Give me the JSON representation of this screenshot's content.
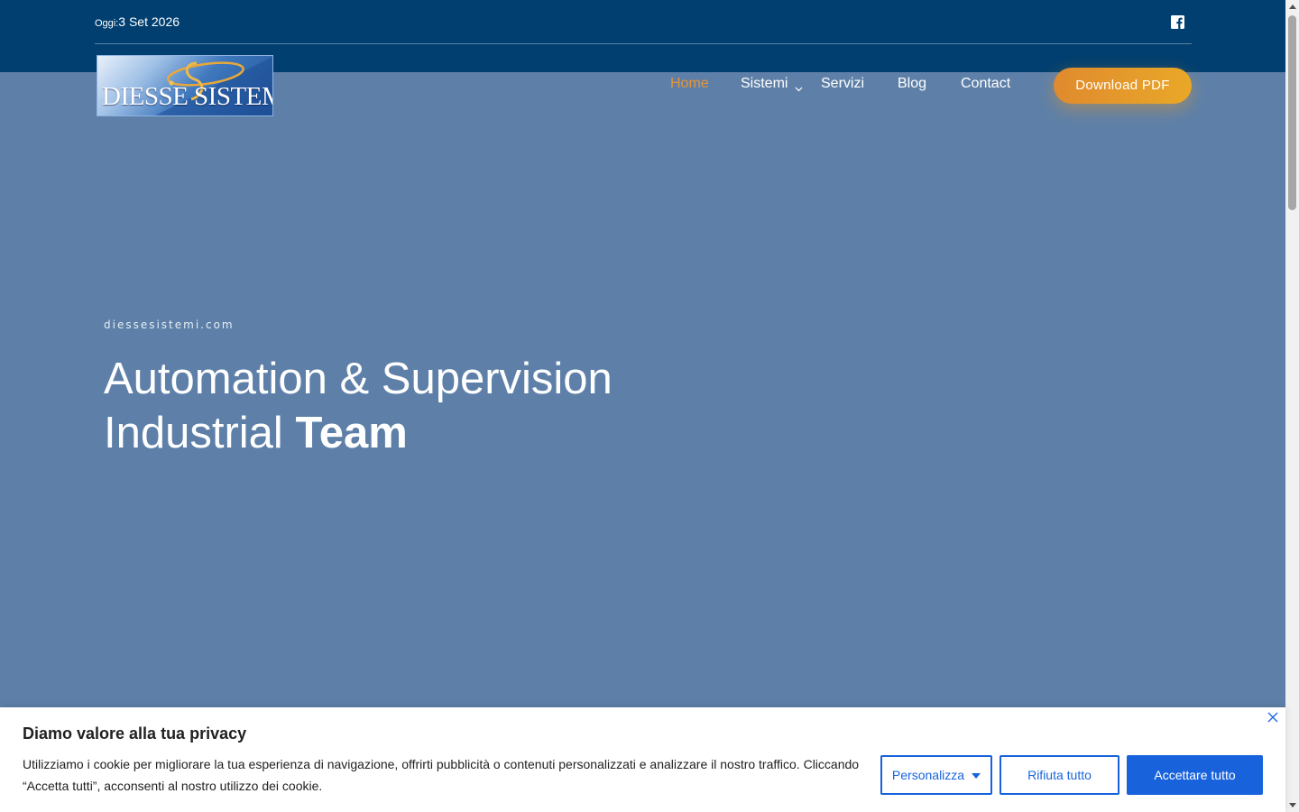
{
  "topbar": {
    "date_label": "Oggi:",
    "date_value": "3 Set 2026",
    "social_icon": "facebook-icon"
  },
  "logo": {
    "text": "DIESSE SISTEMI"
  },
  "nav": {
    "items": [
      {
        "label": "Home",
        "active": true
      },
      {
        "label": "Sistemi",
        "has_dropdown": true
      },
      {
        "label": "Servizi"
      },
      {
        "label": "Blog"
      },
      {
        "label": "Contact"
      }
    ],
    "cta_label": "Download PDF"
  },
  "hero": {
    "kicker": "diessesistemi.com",
    "title_line1": "Automation & Supervision",
    "title_line2_regular": "Industrial ",
    "title_line2_bold": "Team"
  },
  "cookie_banner": {
    "title": "Diamo valore alla tua privacy",
    "text": "Utilizziamo i cookie per migliorare la tua esperienza di navigazione, offrirti pubblicità o contenuti personalizzati e analizzare il nostro traffico. Cliccando “Accetta tutti”, acconsenti al nostro utilizzo dei cookie.",
    "customize_label": "Personalizza",
    "reject_label": "Rifiuta tutto",
    "accept_label": "Accettare tutto"
  },
  "colors": {
    "topbar_bg": "#003f70",
    "hero_bg": "#5e80a8",
    "accent_orange": "#e3953a",
    "cookie_blue": "#1863dc"
  }
}
